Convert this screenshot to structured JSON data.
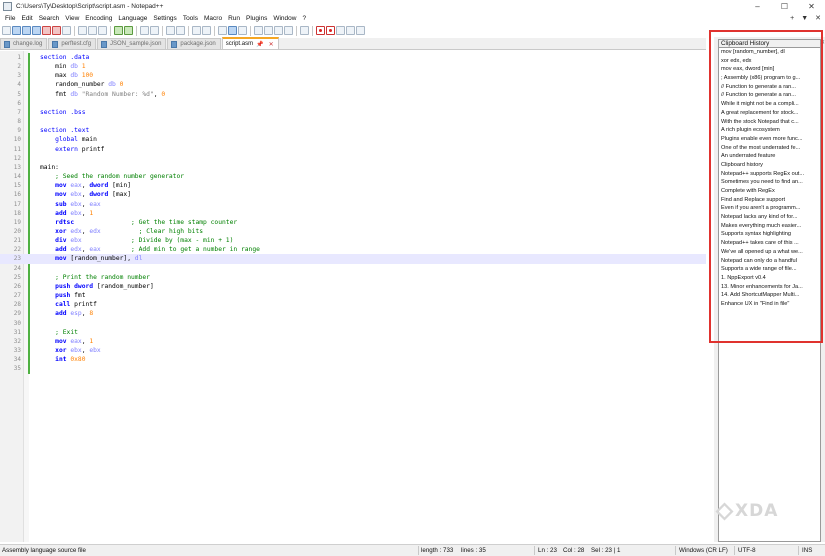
{
  "window": {
    "title": "C:\\Users\\Ty\\Desktop\\Script\\script.asm - Notepad++",
    "controls": [
      "–",
      "☐",
      "✕"
    ]
  },
  "menu": {
    "items": [
      "File",
      "Edit",
      "Search",
      "View",
      "Encoding",
      "Language",
      "Settings",
      "Tools",
      "Macro",
      "Run",
      "Plugins",
      "Window",
      "?"
    ],
    "right_controls": [
      "+",
      "▼",
      "✕"
    ]
  },
  "tabs": [
    {
      "label": "change.log",
      "active": false
    },
    {
      "label": "perftest.cfg",
      "active": false
    },
    {
      "label": "JSON_sample.json",
      "active": false
    },
    {
      "label": "package.json",
      "active": false
    },
    {
      "label": "script.asm",
      "active": true
    }
  ],
  "tab_close_glyph": "✕",
  "tab_pin_glyph": "📌",
  "editor": {
    "current_line": 23,
    "lines": [
      [
        {
          "t": "section ",
          "c": "dir"
        },
        {
          "t": ".data",
          "c": "dir"
        }
      ],
      [
        {
          "t": "    min ",
          "c": "plain"
        },
        {
          "t": "db ",
          "c": "type"
        },
        {
          "t": "1",
          "c": "num"
        }
      ],
      [
        {
          "t": "    max ",
          "c": "plain"
        },
        {
          "t": "db ",
          "c": "type"
        },
        {
          "t": "100",
          "c": "num"
        }
      ],
      [
        {
          "t": "    random_number ",
          "c": "plain"
        },
        {
          "t": "db ",
          "c": "type"
        },
        {
          "t": "0",
          "c": "num"
        }
      ],
      [
        {
          "t": "    fmt ",
          "c": "plain"
        },
        {
          "t": "db ",
          "c": "type"
        },
        {
          "t": "\"Random Number: %d\"",
          "c": "str"
        },
        {
          "t": ", ",
          "c": "plain"
        },
        {
          "t": "0",
          "c": "num"
        }
      ],
      [],
      [
        {
          "t": "section ",
          "c": "dir"
        },
        {
          "t": ".bss",
          "c": "dir"
        }
      ],
      [],
      [
        {
          "t": "section ",
          "c": "dir"
        },
        {
          "t": ".text",
          "c": "dir"
        }
      ],
      [
        {
          "t": "    global ",
          "c": "dir"
        },
        {
          "t": "main",
          "c": "plain"
        }
      ],
      [
        {
          "t": "    extern ",
          "c": "dir"
        },
        {
          "t": "printf",
          "c": "plain"
        }
      ],
      [],
      [
        {
          "t": "main:",
          "c": "label"
        }
      ],
      [
        {
          "t": "    ; Seed the random number generator",
          "c": "cmt"
        }
      ],
      [
        {
          "t": "    mov ",
          "c": "instr"
        },
        {
          "t": "eax",
          "c": "reg"
        },
        {
          "t": ", ",
          "c": "plain"
        },
        {
          "t": "dword ",
          "c": "kwb"
        },
        {
          "t": "[min]",
          "c": "plain"
        }
      ],
      [
        {
          "t": "    mov ",
          "c": "instr"
        },
        {
          "t": "ebx",
          "c": "reg"
        },
        {
          "t": ", ",
          "c": "plain"
        },
        {
          "t": "dword ",
          "c": "kwb"
        },
        {
          "t": "[max]",
          "c": "plain"
        }
      ],
      [
        {
          "t": "    sub ",
          "c": "instr"
        },
        {
          "t": "ebx",
          "c": "reg"
        },
        {
          "t": ", ",
          "c": "plain"
        },
        {
          "t": "eax",
          "c": "reg"
        }
      ],
      [
        {
          "t": "    add ",
          "c": "instr"
        },
        {
          "t": "ebx",
          "c": "reg"
        },
        {
          "t": ", ",
          "c": "plain"
        },
        {
          "t": "1",
          "c": "num"
        }
      ],
      [
        {
          "t": "    rdtsc               ",
          "c": "instr"
        },
        {
          "t": "; Get the time stamp counter",
          "c": "cmt"
        }
      ],
      [
        {
          "t": "    xor ",
          "c": "instr"
        },
        {
          "t": "edx",
          "c": "reg"
        },
        {
          "t": ", ",
          "c": "plain"
        },
        {
          "t": "edx",
          "c": "reg"
        },
        {
          "t": "          ",
          "c": "plain"
        },
        {
          "t": "; Clear high bits",
          "c": "cmt"
        }
      ],
      [
        {
          "t": "    div ",
          "c": "instr"
        },
        {
          "t": "ebx",
          "c": "reg"
        },
        {
          "t": "             ",
          "c": "plain"
        },
        {
          "t": "; Divide by (max - min + 1)",
          "c": "cmt"
        }
      ],
      [
        {
          "t": "    add ",
          "c": "instr"
        },
        {
          "t": "edx",
          "c": "reg"
        },
        {
          "t": ", ",
          "c": "plain"
        },
        {
          "t": "eax",
          "c": "reg"
        },
        {
          "t": "        ",
          "c": "plain"
        },
        {
          "t": "; Add min to get a number in range",
          "c": "cmt"
        }
      ],
      [
        {
          "t": "    mov ",
          "c": "instr"
        },
        {
          "t": "[random_number], ",
          "c": "plain"
        },
        {
          "t": "dl",
          "c": "reg"
        }
      ],
      [],
      [
        {
          "t": "    ; Print the random number",
          "c": "cmt"
        }
      ],
      [
        {
          "t": "    push ",
          "c": "instr"
        },
        {
          "t": "dword ",
          "c": "kwb"
        },
        {
          "t": "[random_number]",
          "c": "plain"
        }
      ],
      [
        {
          "t": "    push ",
          "c": "instr"
        },
        {
          "t": "fmt",
          "c": "plain"
        }
      ],
      [
        {
          "t": "    call ",
          "c": "instr"
        },
        {
          "t": "printf",
          "c": "plain"
        }
      ],
      [
        {
          "t": "    add ",
          "c": "instr"
        },
        {
          "t": "esp",
          "c": "reg"
        },
        {
          "t": ", ",
          "c": "plain"
        },
        {
          "t": "8",
          "c": "num"
        }
      ],
      [],
      [
        {
          "t": "    ; Exit",
          "c": "cmt"
        }
      ],
      [
        {
          "t": "    mov ",
          "c": "instr"
        },
        {
          "t": "eax",
          "c": "reg"
        },
        {
          "t": ", ",
          "c": "plain"
        },
        {
          "t": "1",
          "c": "num"
        }
      ],
      [
        {
          "t": "    xor ",
          "c": "instr"
        },
        {
          "t": "ebx",
          "c": "reg"
        },
        {
          "t": ", ",
          "c": "plain"
        },
        {
          "t": "ebx",
          "c": "reg"
        }
      ],
      [
        {
          "t": "    int ",
          "c": "instr"
        },
        {
          "t": "0x80",
          "c": "num"
        }
      ],
      []
    ]
  },
  "clipboard_panel": {
    "title": "Clipboard History",
    "close_glyph": "✕",
    "items": [
      "mov [random_number], dl",
      " xor edx, edx",
      "mov eax, dword [min]",
      "; Assembly (x86) program to g...",
      "// Function to generate a ran...",
      "// Function to generate a ran...",
      "While it might not be a compli...",
      "A great replacement for stock...",
      "With the stock Notepad that c...",
      "A rich plugin ecosystem",
      "Plugins enable even more func...",
      "One of the most underrated fe...",
      "An underrated feature",
      "Clipboard history",
      "Notepad++ supports RegEx out...",
      "Sometimes you need to find an...",
      "Complete with RegEx",
      "Find and Replace support",
      "Even if you aren't a programm...",
      "Notepad lacks any kind of for...",
      "Makes everything much easier...",
      "Supports syntax highlighting",
      "Notepad++ takes care of this ...",
      "We've all opened up a what we...",
      "Notepad can only do a handful",
      "Supports a wide range of file...",
      "1.  NppExport v0.4",
      "13. Minor enhancements for Ja...",
      "14. Add ShortcutMapper Multi...",
      "Enhance UX in \"Find in file\""
    ]
  },
  "watermark": {
    "text": "XDA"
  },
  "status": {
    "language": "Assembly language source file",
    "length": "length : 733",
    "lines": "lines : 35",
    "ln": "Ln : 23",
    "col": "Col : 28",
    "sel": "Sel : 23 | 1",
    "eol": "Windows (CR LF)",
    "encoding": "UTF-8",
    "mode": "INS"
  },
  "colors": {
    "accent_tab": "#f5a623",
    "change_bar": "#4fb142",
    "highlight_box": "#e0322e",
    "current_line": "#e8e8ff"
  }
}
